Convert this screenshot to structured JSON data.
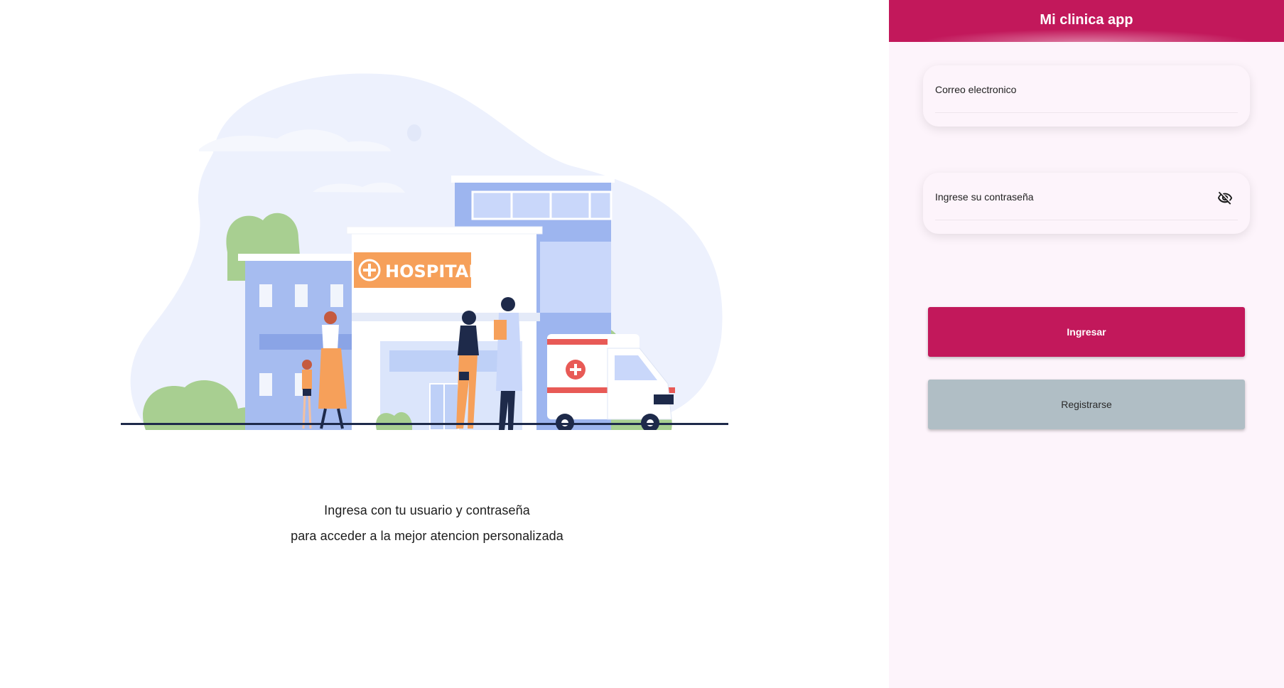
{
  "app": {
    "title": "Mi clinica app"
  },
  "illustration": {
    "sign_text": "HOSPITAL"
  },
  "tagline": {
    "line1": "Ingresa con tu usuario y contraseña",
    "line2": "para acceder a la mejor atencion personalizada"
  },
  "form": {
    "email": {
      "label": "Correo electronico",
      "value": "",
      "icon": "email-field"
    },
    "password": {
      "label": "Ingrese su contraseña",
      "value": "",
      "toggle_icon": "eye-off-icon"
    },
    "login_label": "Ingresar",
    "register_label": "Registrarse"
  },
  "colors": {
    "primary": "#c2185b",
    "secondary_button": "#b0bec5",
    "panel_background": "#fdf4fb",
    "sign_orange": "#f6a05a",
    "building_blue": "#9db5ef"
  }
}
